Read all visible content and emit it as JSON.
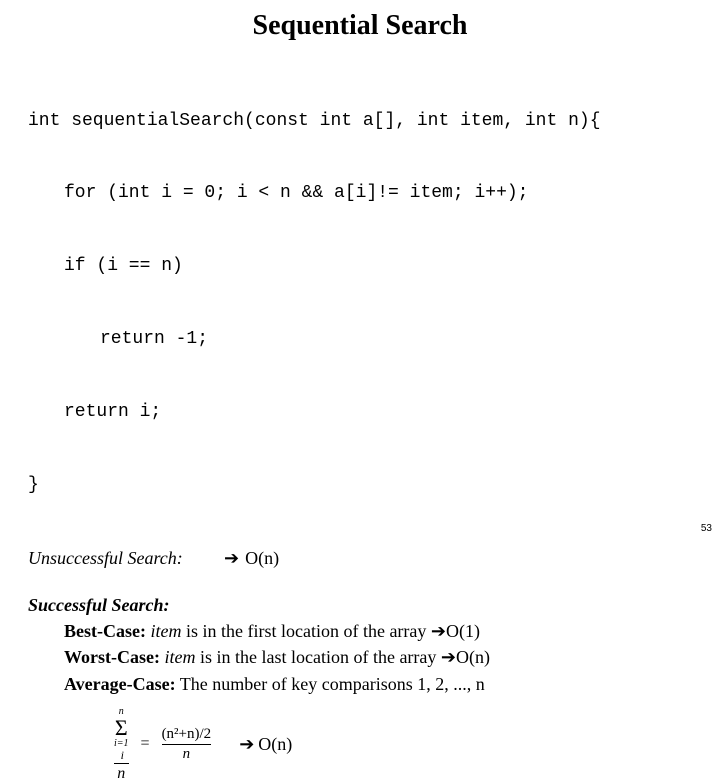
{
  "title": "Sequential Search",
  "code": {
    "l1": "int sequentialSearch(const int a[], int item, int n){",
    "l2": "for (int i = 0; i < n && a[i]!= item; i++);",
    "l3": "if (i == n)",
    "l4": "return -1;",
    "l5": "return i;",
    "l6": "}"
  },
  "unsuccessful": {
    "label": "Unsuccessful Search:",
    "arrow": "➔",
    "complexity": "O(n)"
  },
  "successful": {
    "heading": "Successful Search:",
    "best": {
      "label": "Best-Case:",
      "text_prefix": " item",
      "text_rest": " is in the first location of the array ",
      "arrow": "➔",
      "complexity": "O(1)"
    },
    "worst": {
      "label": "Worst-Case:",
      "text_prefix": " item",
      "text_rest": " is in the last location of the array ",
      "arrow": "➔",
      "complexity": "O(n)"
    },
    "average": {
      "label": "Average-Case:",
      "text": " The number of key comparisons 1, 2, ..., n"
    }
  },
  "formula": {
    "sigma_top": "n",
    "sigma_bot": "i=1",
    "sigma_var": "i",
    "den1": "n",
    "eq": "=",
    "rhs_num": "(n²+n)/2",
    "rhs_den": "n",
    "arrow": "➔",
    "complexity": "O(n)"
  },
  "page": "53"
}
